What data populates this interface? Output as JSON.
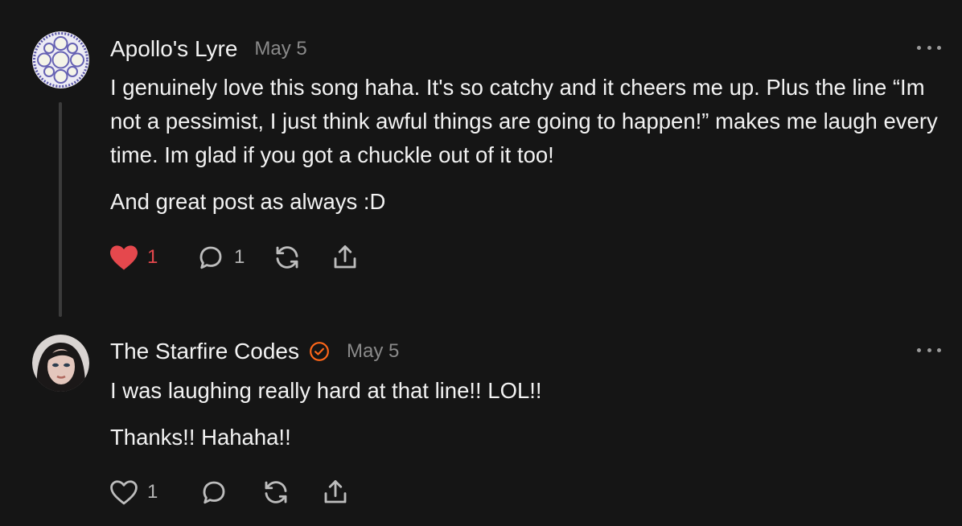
{
  "comments": [
    {
      "author": "Apollo's Lyre",
      "date": "May 5",
      "verified": false,
      "avatar_icon": "patterned-avatar",
      "paragraphs": [
        "I genuinely love this song haha. It's so catchy and it cheers me up. Plus the line “Im not a pessimist, I just think awful things are going to happen!” makes me laugh every time. Im glad if you got a chuckle out of it too!",
        "And great post as always :D"
      ],
      "likes": "1",
      "liked": true,
      "replies": "1",
      "colors": {
        "heart": "#e5484d"
      }
    },
    {
      "author": "The Starfire Codes",
      "date": "May 5",
      "verified": true,
      "avatar_icon": "profile-photo-avatar",
      "paragraphs": [
        "I was laughing really hard at that line!! LOL!!",
        "Thanks!! Hahaha!!"
      ],
      "likes": "1",
      "liked": false,
      "replies": "",
      "colors": {
        "verified": "#ff6719"
      }
    }
  ],
  "icons": [
    "heart-icon",
    "comment-icon",
    "restack-icon",
    "share-icon",
    "more-icon",
    "verified-badge-icon"
  ]
}
